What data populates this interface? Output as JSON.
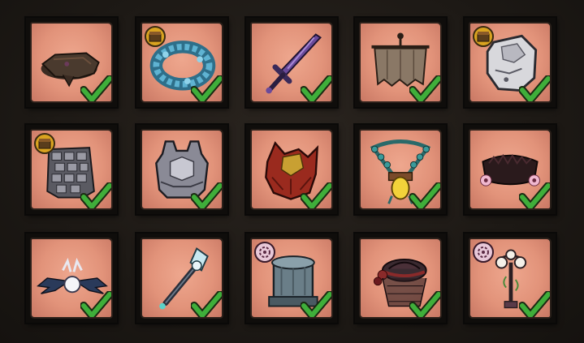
{
  "grid": {
    "items": [
      {
        "icon": "dark-stump-icon",
        "badge": null,
        "checked": true
      },
      {
        "icon": "blue-wreath-icon",
        "badge": "chest-badge-icon",
        "checked": true
      },
      {
        "icon": "purple-sword-icon",
        "badge": null,
        "checked": true
      },
      {
        "icon": "banner-icon",
        "badge": null,
        "checked": true
      },
      {
        "icon": "stone-golem-icon",
        "badge": "chest-badge-icon",
        "checked": true
      },
      {
        "icon": "stone-cloak-icon",
        "badge": "chest-badge-icon",
        "checked": true
      },
      {
        "icon": "stone-armor-icon",
        "badge": null,
        "checked": true
      },
      {
        "icon": "feather-helmet-icon",
        "badge": null,
        "checked": true
      },
      {
        "icon": "amulet-icon",
        "badge": null,
        "checked": true
      },
      {
        "icon": "flower-bed-icon",
        "badge": null,
        "checked": true
      },
      {
        "icon": "winged-orb-icon",
        "badge": null,
        "checked": true
      },
      {
        "icon": "crystal-staff-icon",
        "badge": null,
        "checked": true
      },
      {
        "icon": "stone-pillar-icon",
        "badge": "spiral-badge-icon",
        "checked": true
      },
      {
        "icon": "veiled-hat-icon",
        "badge": null,
        "checked": true
      },
      {
        "icon": "lamp-post-icon",
        "badge": "spiral-badge-icon",
        "checked": true
      }
    ]
  },
  "colors": {
    "card": "#e2937a",
    "check": "#3fae3a",
    "background": "#1d1915"
  }
}
